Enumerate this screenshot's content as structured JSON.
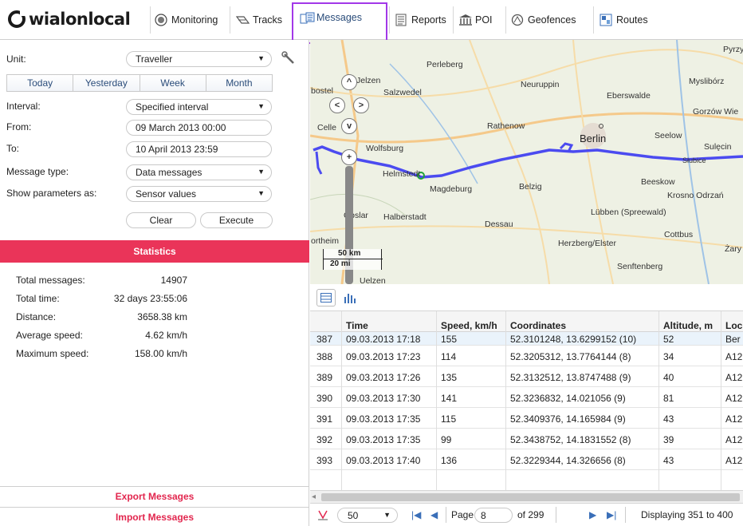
{
  "brand": {
    "name_main": "wialon",
    "name_accent": "local"
  },
  "nav": [
    {
      "label": "Monitoring"
    },
    {
      "label": "Tracks"
    },
    {
      "label": "Messages"
    },
    {
      "label": "Reports"
    },
    {
      "label": "POI"
    },
    {
      "label": "Geofences"
    },
    {
      "label": "Routes"
    }
  ],
  "form": {
    "unit_label": "Unit:",
    "unit_value": "Traveller",
    "tabs": [
      "Today",
      "Yesterday",
      "Week",
      "Month"
    ],
    "interval_label": "Interval:",
    "interval_value": "Specified interval",
    "from_label": "From:",
    "from_value": "09 March 2013 00:00",
    "to_label": "To:",
    "to_value": "10 April 2013 23:59",
    "msgtype_label": "Message type:",
    "msgtype_value": "Data messages",
    "params_label": "Show parameters as:",
    "params_value": "Sensor values",
    "clear_label": "Clear",
    "execute_label": "Execute"
  },
  "statistics": {
    "title": "Statistics",
    "rows": [
      {
        "label": "Total messages:",
        "value": "14907"
      },
      {
        "label": "Total time:",
        "value": "32 days 23:55:06"
      },
      {
        "label": "Distance:",
        "value": "3658.38 km"
      },
      {
        "label": "Average speed:",
        "value": "4.62 km/h"
      },
      {
        "label": "Maximum speed:",
        "value": "158.00 km/h"
      }
    ]
  },
  "export_label": "Export Messages",
  "import_label": "Import Messages",
  "map": {
    "scale_km": "50 km",
    "scale_mi": "20 mi",
    "cities": [
      "Pyrzyce",
      "Perleberg",
      "Neuruppin",
      "Myslibórz",
      "Salzwedel",
      "Eberswalde",
      "Gorzów Wie",
      "Celle",
      "Rathenow",
      "Berlin",
      "Seelow",
      "Wolfsburg",
      "Sulęcin",
      "Helmstedt",
      "Słubice",
      "Magdeburg",
      "Belzig",
      "Beeskow",
      "Krosno Odrzań",
      "Goslar",
      "Halberstadt",
      "Lübben (Spreewald)",
      "Dessau",
      "Cottbus",
      "Herzberg/Elster",
      "Żary",
      "Senftenberg",
      "Jelzen",
      "bostel",
      "ortheim",
      "Uelzen"
    ]
  },
  "table": {
    "headers": [
      "",
      "Time",
      "Speed, km/h",
      "Coordinates",
      "Altitude, m",
      "Loc"
    ],
    "rows": [
      [
        "387",
        "09.03.2013 17:18",
        "155",
        "52.3101248, 13.6299152 (10)",
        "52",
        "Ber"
      ],
      [
        "388",
        "09.03.2013 17:23",
        "114",
        "52.3205312, 13.7764144 (8)",
        "34",
        "A12"
      ],
      [
        "389",
        "09.03.2013 17:26",
        "135",
        "52.3132512, 13.8747488 (9)",
        "40",
        "A12"
      ],
      [
        "390",
        "09.03.2013 17:30",
        "141",
        "52.3236832, 14.021056 (9)",
        "81",
        "A12"
      ],
      [
        "391",
        "09.03.2013 17:35",
        "115",
        "52.3409376, 14.165984 (9)",
        "43",
        "A12"
      ],
      [
        "392",
        "09.03.2013 17:35",
        "99",
        "52.3438752, 14.1831552 (8)",
        "39",
        "A12"
      ],
      [
        "393",
        "09.03.2013 17:40",
        "136",
        "52.3229344, 14.326656 (8)",
        "43",
        "A12"
      ]
    ]
  },
  "pager": {
    "per_page": "50",
    "page_label": "Page",
    "page_value": "8",
    "of_label": "of 299",
    "display_text": "Displaying 351 to 400"
  },
  "colors": {
    "accent": "#ea3459",
    "highlight": "#a238e8",
    "track": "#4b4bf0"
  }
}
